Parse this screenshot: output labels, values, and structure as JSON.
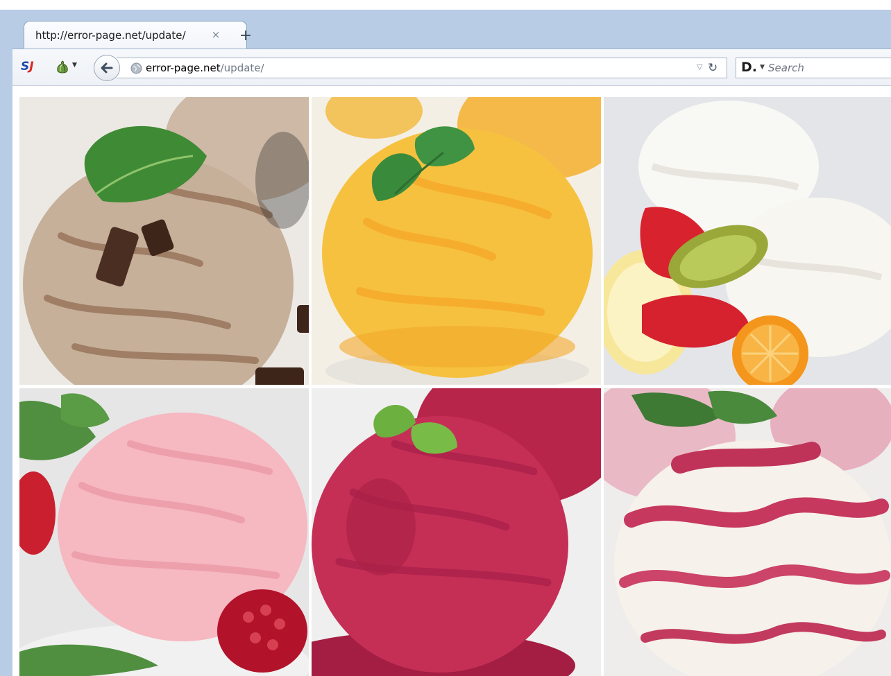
{
  "browser": {
    "tab": {
      "title": "http://error-page.net/update/",
      "close_glyph": "×"
    },
    "new_tab_glyph": "+",
    "urlbar": {
      "host": "error-page.net",
      "path": "/update/"
    },
    "search": {
      "engine_glyph": "D.",
      "placeholder": "Search"
    },
    "toolbar_icons": [
      "sj-logo-icon",
      "tor-onion-icon",
      "back-arrow-icon",
      "globe-icon",
      "history-dropdown-icon",
      "reload-icon"
    ]
  },
  "gallery": {
    "items": [
      {
        "subject": "chocolate-chip-scoop",
        "colors": {
          "base": "#c9b49e",
          "accent": "#5b3a2a",
          "bg": "#eceae6"
        }
      },
      {
        "subject": "mango-scoop",
        "colors": {
          "base": "#f7c44a",
          "accent": "#f4a82a",
          "bg": "#f5f1e8"
        }
      },
      {
        "subject": "vanilla-fruit-scoops",
        "colors": {
          "base": "#f7f6f2",
          "accent": "#d8232f",
          "bg": "#e5e6e8"
        }
      },
      {
        "subject": "strawberry-scoop",
        "colors": {
          "base": "#f5b8c2",
          "accent": "#c8283a",
          "bg": "#e8e8e8"
        }
      },
      {
        "subject": "raspberry-sorbet-scoop",
        "colors": {
          "base": "#c42f55",
          "accent": "#a81f44",
          "bg": "#eeeeee"
        }
      },
      {
        "subject": "berry-swirl-scoop",
        "colors": {
          "base": "#f6f1ea",
          "accent": "#c6385e",
          "bg": "#f0eded"
        }
      }
    ]
  }
}
